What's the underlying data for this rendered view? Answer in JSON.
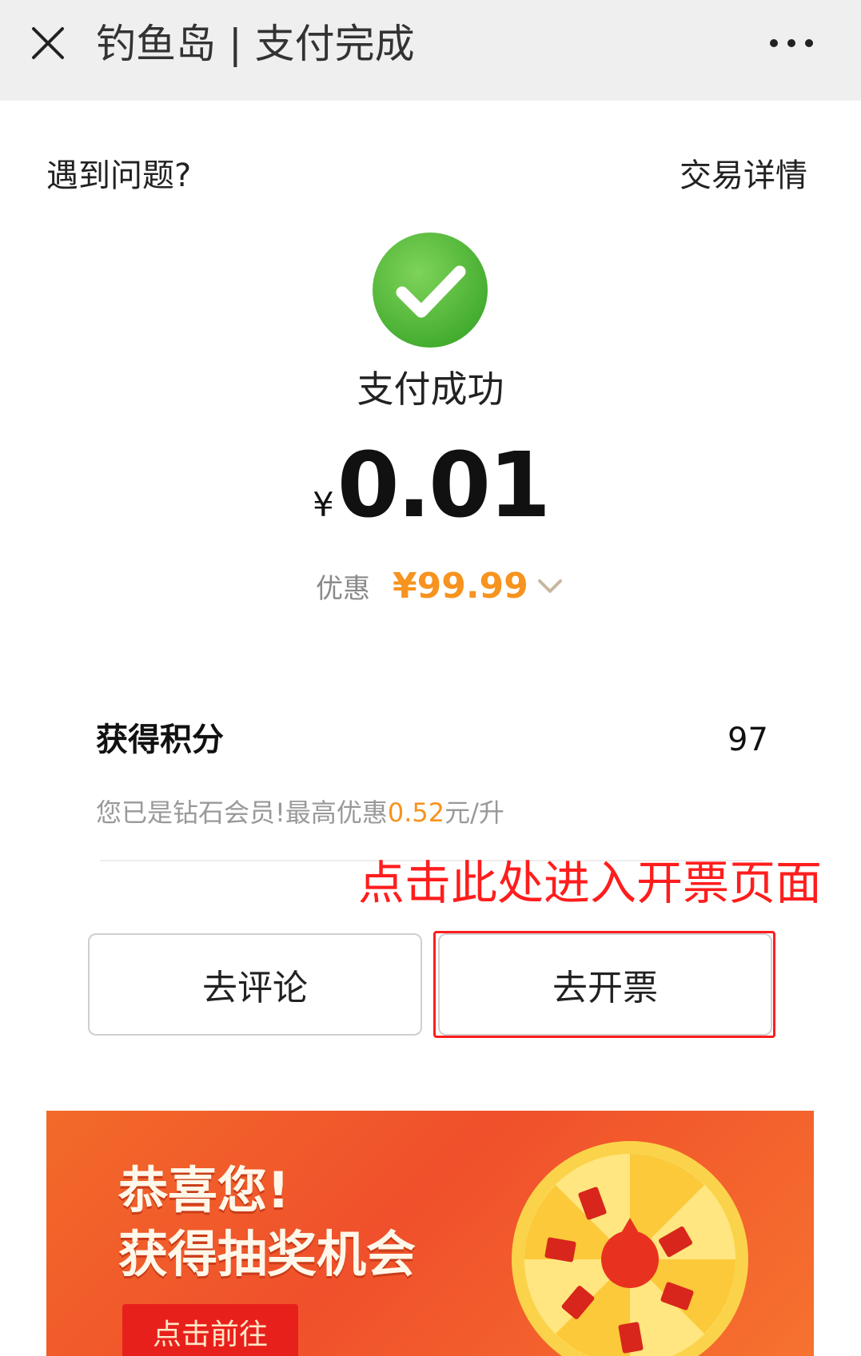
{
  "header": {
    "title": "钓鱼岛 | 支付完成"
  },
  "links": {
    "problem": "遇到问题?",
    "details": "交易详情"
  },
  "payment": {
    "status": "支付成功",
    "currency": "¥",
    "amount": "0.01",
    "discount_label": "优惠",
    "discount_value": "¥99.99"
  },
  "points": {
    "label": "获得积分",
    "value": "97",
    "note_prefix": "您已是钻石会员!最高优惠",
    "note_highlight": "0.52",
    "note_suffix": "元/升"
  },
  "annotation": "点击此处进入开票页面",
  "actions": {
    "review": "去评论",
    "invoice": "去开票"
  },
  "banner": {
    "line1": "恭喜您!",
    "line2": "获得抽奖机会",
    "button": "点击前往"
  },
  "colors": {
    "success": "#5cc13b",
    "accent": "#f7931e",
    "annotation": "#ff1d1d"
  }
}
